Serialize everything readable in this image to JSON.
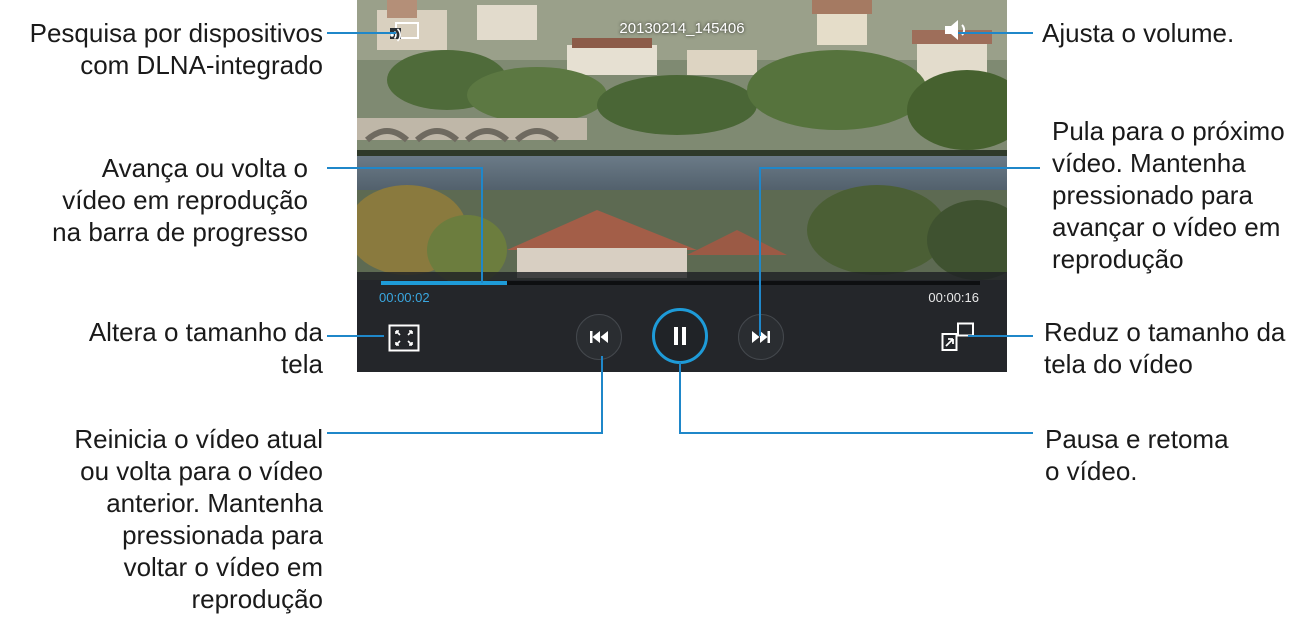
{
  "player": {
    "file_name": "20130214_145406",
    "elapsed_time": "00:00:02",
    "total_time": "00:00:16",
    "progress_fraction": 0.21,
    "accent_color": "#1e9bd8"
  },
  "icons": {
    "dlna": "dlna-device-search-icon",
    "volume": "volume-icon",
    "fit": "screen-size-icon",
    "popup": "popup-player-icon",
    "previous": "previous-icon",
    "pause": "pause-icon",
    "next": "next-icon"
  },
  "callouts": {
    "dlna": [
      "Pesquisa por  dispositivos",
      "com DLNA-integrado"
    ],
    "volume": [
      "Ajusta o volume."
    ],
    "progress": [
      "Avança ou volta o",
      "vídeo em reprodução",
      "na barra de progresso"
    ],
    "next": [
      "Pula para o próximo",
      "vídeo. Mantenha",
      "pressionado para",
      "avançar o vídeo em",
      "reprodução"
    ],
    "screen_size": [
      "Altera o tamanho da",
      "tela"
    ],
    "popup": [
      "Reduz o tamanho da",
      "tela do vídeo"
    ],
    "previous": [
      "Reinicia o vídeo atual",
      "ou volta para o vídeo",
      "anterior. Mantenha",
      "pressionada para",
      "voltar o vídeo em",
      "reprodução"
    ],
    "pause": [
      "Pausa e retoma",
      "o vídeo."
    ]
  }
}
